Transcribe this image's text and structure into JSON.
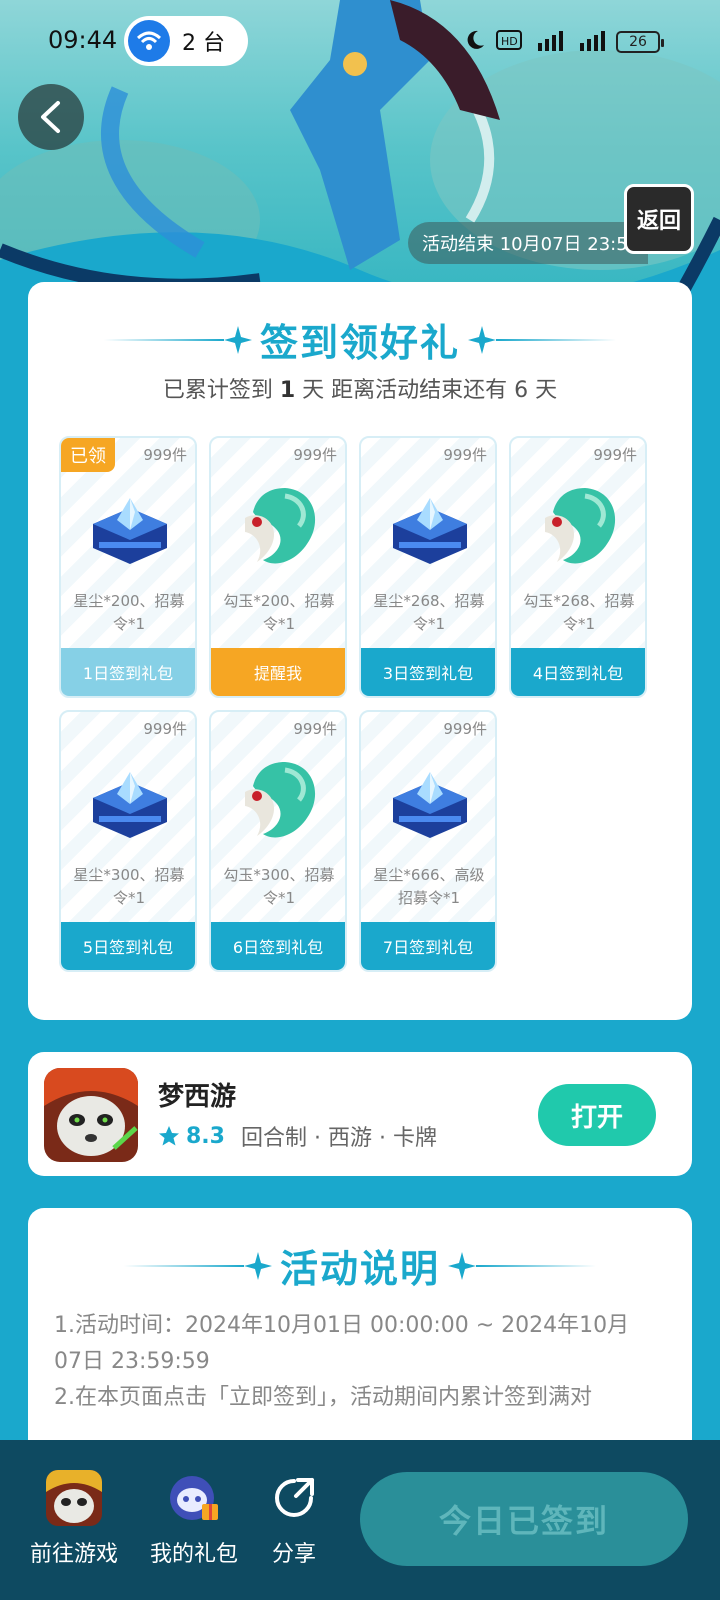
{
  "status_bar": {
    "time": "09:44",
    "hotspot_count": "2 台",
    "battery": "26"
  },
  "hero": {
    "activity_end": "活动结束 10月07日 23:59",
    "return_label": "返回"
  },
  "signin": {
    "title": "签到领好礼",
    "summary_prefix": "已累计签到",
    "summary_days": "1",
    "summary_suffix": "天  距离活动结束还有 6 天",
    "rewards": [
      {
        "count": "999件",
        "claimed": "已领",
        "item": "stardust",
        "desc": "星尘*200、招募令*1",
        "button": "1日签到礼包",
        "state": "done"
      },
      {
        "count": "999件",
        "item": "jade",
        "desc": "勾玉*200、招募令*1",
        "button": "提醒我",
        "state": "remind"
      },
      {
        "count": "999件",
        "item": "stardust",
        "desc": "星尘*268、招募令*1",
        "button": "3日签到礼包",
        "state": "normal"
      },
      {
        "count": "999件",
        "item": "jade",
        "desc": "勾玉*268、招募令*1",
        "button": "4日签到礼包",
        "state": "normal"
      },
      {
        "count": "999件",
        "item": "stardust",
        "desc": "星尘*300、招募令*1",
        "button": "5日签到礼包",
        "state": "normal"
      },
      {
        "count": "999件",
        "item": "jade",
        "desc": "勾玉*300、招募令*1",
        "button": "6日签到礼包",
        "state": "normal"
      },
      {
        "count": "999件",
        "item": "stardust",
        "desc": "星尘*666、高级招募令*1",
        "button": "7日签到礼包",
        "state": "normal"
      }
    ]
  },
  "game": {
    "name": "梦西游",
    "rating": "8.3",
    "tags": "回合制 · 西游 · 卡牌",
    "open_label": "打开"
  },
  "rules": {
    "title": "活动说明",
    "line1": "1.活动时间：2024年10月01日 00:00:00 ~ 2024年10月07日 23:59:59",
    "line2": "2.在本页面点击「立即签到」，活动期间内累计签到满对"
  },
  "bottom_bar": {
    "go_game": "前往游戏",
    "my_gifts": "我的礼包",
    "share": "分享",
    "signed": "今日已签到"
  },
  "colors": {
    "accent": "#1aa8cc",
    "remind": "#f6a623",
    "open_button": "#20c9ac",
    "bottom_bar": "#0e4a61"
  }
}
